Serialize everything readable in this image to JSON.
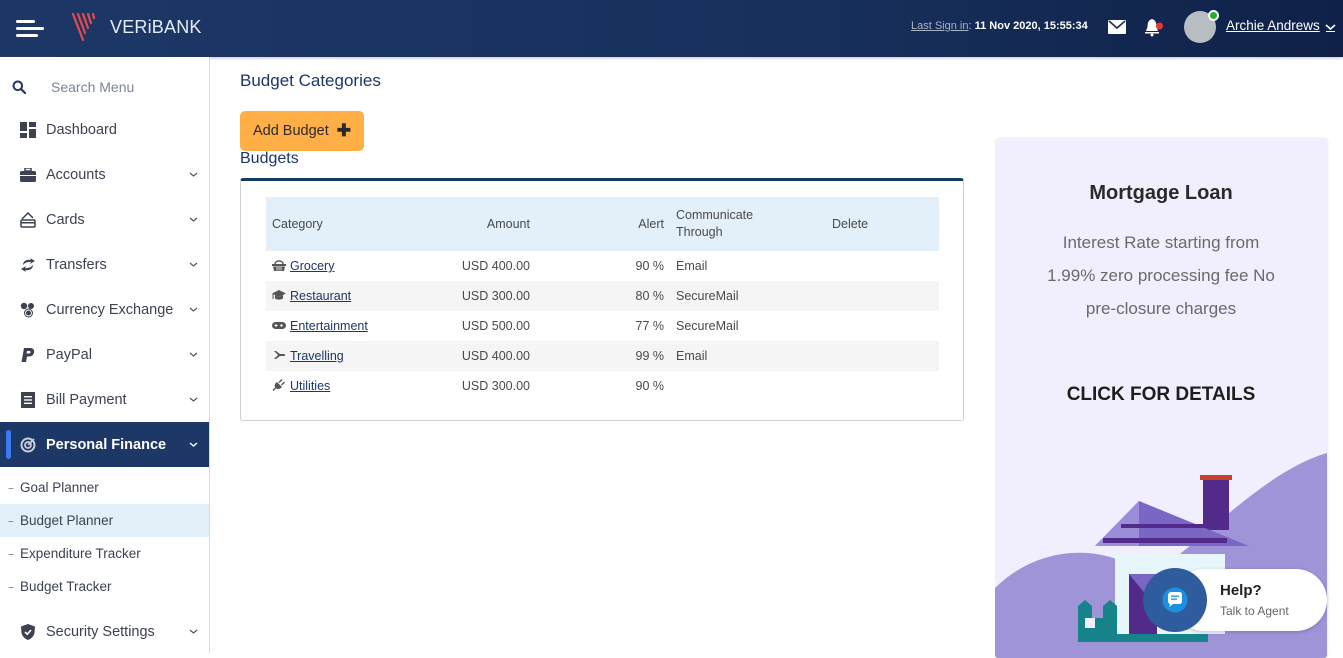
{
  "header": {
    "brand": "VERiBANK",
    "last_sign_in_label": "Last Sign in",
    "last_sign_in_value": "11 Nov 2020, 15:55:34",
    "username": "Archie Andrews",
    "status": "online"
  },
  "sidebar": {
    "search_placeholder": "Search Menu",
    "items": [
      {
        "label": "Dashboard",
        "icon": "dashboard-icon",
        "has_submenu": false
      },
      {
        "label": "Accounts",
        "icon": "briefcase-icon",
        "has_submenu": true
      },
      {
        "label": "Cards",
        "icon": "card-icon",
        "has_submenu": true
      },
      {
        "label": "Transfers",
        "icon": "transfer-icon",
        "has_submenu": true
      },
      {
        "label": "Currency Exchange",
        "icon": "coins-icon",
        "has_submenu": true
      },
      {
        "label": "PayPal",
        "icon": "paypal-icon",
        "has_submenu": true
      },
      {
        "label": "Bill Payment",
        "icon": "bill-icon",
        "has_submenu": true
      },
      {
        "label": "Personal Finance",
        "icon": "target-icon",
        "has_submenu": true,
        "active": true
      },
      {
        "label": "Security Settings",
        "icon": "shield-icon",
        "has_submenu": true
      }
    ],
    "subitems": [
      {
        "label": "Goal Planner"
      },
      {
        "label": "Budget Planner",
        "selected": true
      },
      {
        "label": "Expenditure Tracker"
      },
      {
        "label": "Budget Tracker"
      }
    ]
  },
  "main": {
    "title": "Budget Categories",
    "add_button": "Add Budget",
    "section_label": "Budgets",
    "table": {
      "headers": [
        "Category",
        "Amount",
        "Alert",
        "Communicate Through",
        "Delete"
      ],
      "rows": [
        {
          "icon": "basket-icon",
          "category": "Grocery",
          "amount": "USD 400.00",
          "alert": "90 %",
          "communicate": "Email"
        },
        {
          "icon": "graduation-cap-icon",
          "category": "Restaurant",
          "amount": "USD 300.00",
          "alert": "80 %",
          "communicate": "SecureMail"
        },
        {
          "icon": "gamepad-icon",
          "category": "Entertainment",
          "amount": "USD 500.00",
          "alert": "77 %",
          "communicate": "SecureMail"
        },
        {
          "icon": "plane-icon",
          "category": "Travelling",
          "amount": "USD 400.00",
          "alert": "99 %",
          "communicate": "Email"
        },
        {
          "icon": "plug-icon",
          "category": "Utilities",
          "amount": "USD 300.00",
          "alert": "90 %",
          "communicate": ""
        }
      ]
    }
  },
  "ad": {
    "title": "Mortgage Loan",
    "body": "Interest Rate starting from 1.99% zero processing fee No pre-closure charges",
    "cta": "CLICK FOR DETAILS"
  },
  "help": {
    "title": "Help?",
    "subtitle": "Talk to Agent"
  },
  "colors": {
    "header_bg": "#1d3767",
    "accent_orange": "#ffaf45",
    "active_indicator": "#3a7bf0",
    "table_header_bg": "#e3f0fa",
    "ad_bg": "#f1effd",
    "notification_dot": "#e53935",
    "online_dot": "#22b02c"
  }
}
